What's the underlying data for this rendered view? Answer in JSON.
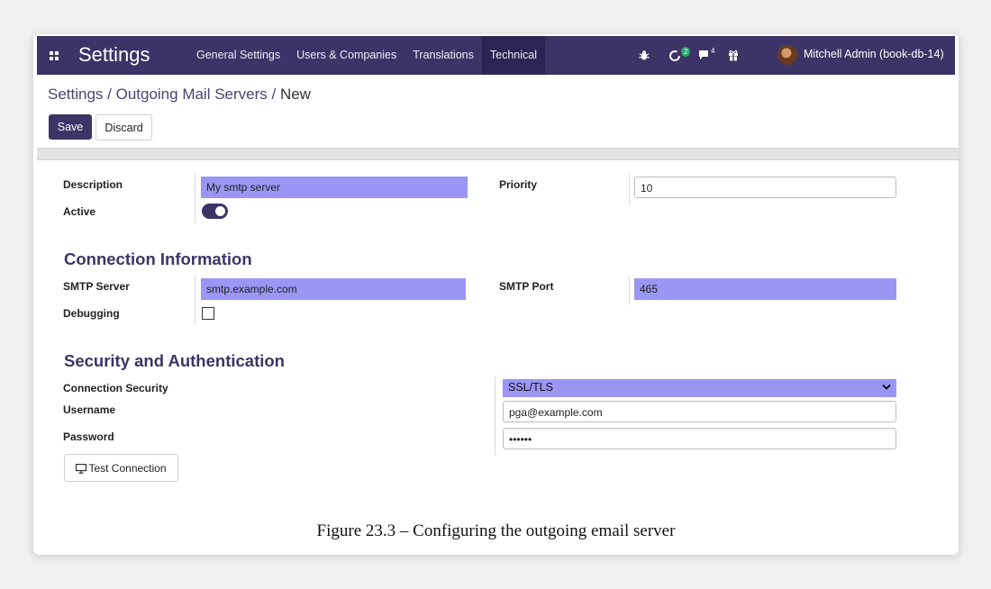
{
  "topbar": {
    "app_title": "Settings",
    "menu": [
      "General Settings",
      "Users & Companies",
      "Translations",
      "Technical"
    ],
    "active_menu": "Technical",
    "activity_count": "2",
    "messages_count": "4",
    "user_name": "Mitchell Admin (book-db-14)"
  },
  "breadcrumb": {
    "parent": "Settings / Outgoing Mail Servers / ",
    "current": "New"
  },
  "actions": {
    "save": "Save",
    "discard": "Discard"
  },
  "form": {
    "description_label": "Description",
    "description_value": "My smtp server",
    "active_label": "Active",
    "active_value": true,
    "priority_label": "Priority",
    "priority_value": "10",
    "connection_section": "Connection Information",
    "smtp_server_label": "SMTP Server",
    "smtp_server_value": "smtp.example.com",
    "smtp_port_label": "SMTP Port",
    "smtp_port_value": "465",
    "debugging_label": "Debugging",
    "debugging_value": false,
    "security_section": "Security and Authentication",
    "connection_security_label": "Connection Security",
    "connection_security_value": "SSL/TLS",
    "username_label": "Username",
    "username_value": "pga@example.com",
    "password_label": "Password",
    "password_value": "••••••",
    "test_button": "Test Connection"
  },
  "caption": "Figure 23.3 – Configuring the outgoing email server",
  "colors": {
    "brand": "#3c3466",
    "highlight": "#9b96f3",
    "badge": "#2aa56a"
  }
}
